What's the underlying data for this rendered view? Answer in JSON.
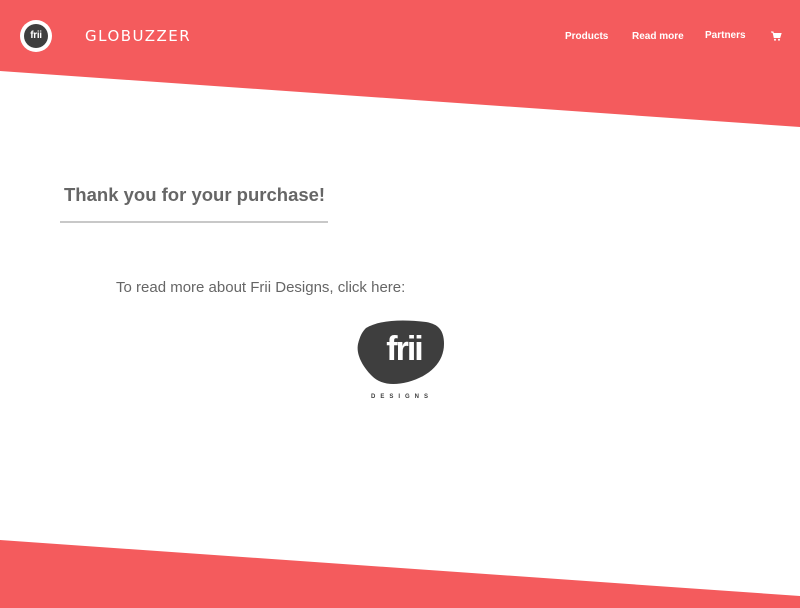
{
  "header": {
    "badge_text": "frii",
    "brand_name": "GLOBUZZER",
    "nav": {
      "products": "Products",
      "read_more": "Read more",
      "partners": "Partners"
    },
    "cart_icon": "cart-icon"
  },
  "main": {
    "title": "Thank you for your purchase!",
    "read_more_text": "To read more about Frii Designs, click here:",
    "logo": {
      "wordmark": "frii",
      "subtitle": "DESIGNS"
    }
  },
  "colors": {
    "accent": "#f45b5d",
    "text_gray": "#666666",
    "logo_dark": "#3e3e3e"
  }
}
